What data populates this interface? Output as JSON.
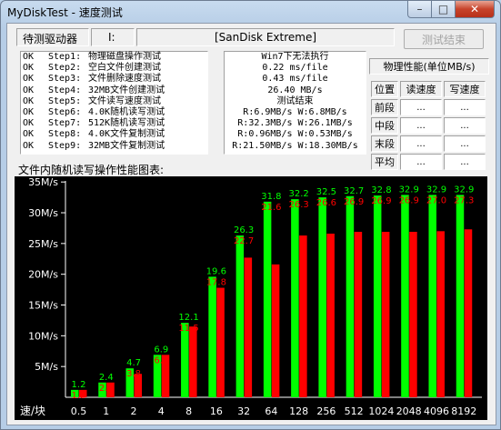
{
  "window": {
    "title": "MyDiskTest - 速度测试",
    "min_glyph": "–",
    "max_glyph": "□",
    "close_glyph": "✕"
  },
  "drive": {
    "label": "待测驱动器",
    "letter": "I:",
    "name": "[SanDisk Extreme]",
    "button": "测试结束"
  },
  "steps": [
    {
      "status": "OK",
      "step": "Step1:",
      "name": "物理磁盘操作测试"
    },
    {
      "status": "OK",
      "step": "Step2:",
      "name": "空白文件创建测试"
    },
    {
      "status": "OK",
      "step": "Step3:",
      "name": "文件删除速度测试"
    },
    {
      "status": "OK",
      "step": "Step4:",
      "name": "32MB文件创建测试"
    },
    {
      "status": "OK",
      "step": "Step5:",
      "name": "文件读写速度测试"
    },
    {
      "status": "OK",
      "step": "Step6:",
      "name": "4.0K随机读写测试"
    },
    {
      "status": "OK",
      "step": "Step7:",
      "name": "512K随机读写测试"
    },
    {
      "status": "OK",
      "step": "Step8:",
      "name": "4.0K文件复制测试"
    },
    {
      "status": "OK",
      "step": "Step9:",
      "name": "32MB文件复制测试"
    }
  ],
  "results": [
    "Win7下无法执行",
    "0.22 ms/file",
    "0.43 ms/file",
    "26.40 MB/s",
    "测试结束",
    "R:6.9MB/s W:6.8MB/s",
    "R:32.3MB/s W:26.1MB/s",
    "R:0.96MB/s W:0.53MB/s",
    "R:21.50MB/s W:18.30MB/s"
  ],
  "perf": {
    "title": "物理性能(单位MB/s)",
    "headers": [
      "位置",
      "读速度",
      "写速度"
    ],
    "rows": [
      {
        "pos": "前段",
        "read": "...",
        "write": "..."
      },
      {
        "pos": "中段",
        "read": "...",
        "write": "..."
      },
      {
        "pos": "末段",
        "read": "...",
        "write": "..."
      },
      {
        "pos": "平均",
        "read": "...",
        "write": "..."
      }
    ]
  },
  "chart_title": "文件内随机读写操作性能图表:",
  "colors": {
    "read": "#00ff00",
    "write": "#ff0000",
    "bg": "#000000",
    "axis": "#ffffff"
  },
  "chart_data": {
    "type": "bar",
    "x_axis_title": "速/块",
    "categories": [
      "0.5",
      "1",
      "2",
      "4",
      "8",
      "16",
      "32",
      "64",
      "128",
      "256",
      "512",
      "1024",
      "2048",
      "4096",
      "8192"
    ],
    "ylim": [
      0,
      35
    ],
    "yticks": [
      "5M/s",
      "10M/s",
      "15M/s",
      "20M/s",
      "25M/s",
      "30M/s",
      "35M/s"
    ],
    "series": [
      {
        "values": [
          1.2,
          2.4,
          4.7,
          6.9,
          12.1,
          19.6,
          26.3,
          31.8,
          32.2,
          32.5,
          32.7,
          32.8,
          32.9,
          32.9,
          32.9
        ],
        "labels": [
          "1.2",
          "2.4",
          "4.7",
          "6.9",
          "12.1",
          "19.6",
          "26.3",
          "31.8",
          "32.2",
          "32.5",
          "32.7",
          "32.8",
          "32.9",
          "32.9",
          "32.9"
        ]
      },
      {
        "values": [
          1.2,
          2.4,
          3.8,
          6.9,
          11.5,
          17.8,
          22.7,
          21.6,
          26.3,
          26.6,
          26.9,
          26.9,
          26.9,
          27.0,
          27.3
        ],
        "labels": [
          "1.2",
          "2.4",
          "3.8",
          "6.9",
          "11.5",
          "17.8",
          "22.7",
          "21.6",
          "26.3",
          "26.6",
          "26.9",
          "26.9",
          "26.9",
          "27.0",
          "27.3"
        ]
      }
    ]
  }
}
